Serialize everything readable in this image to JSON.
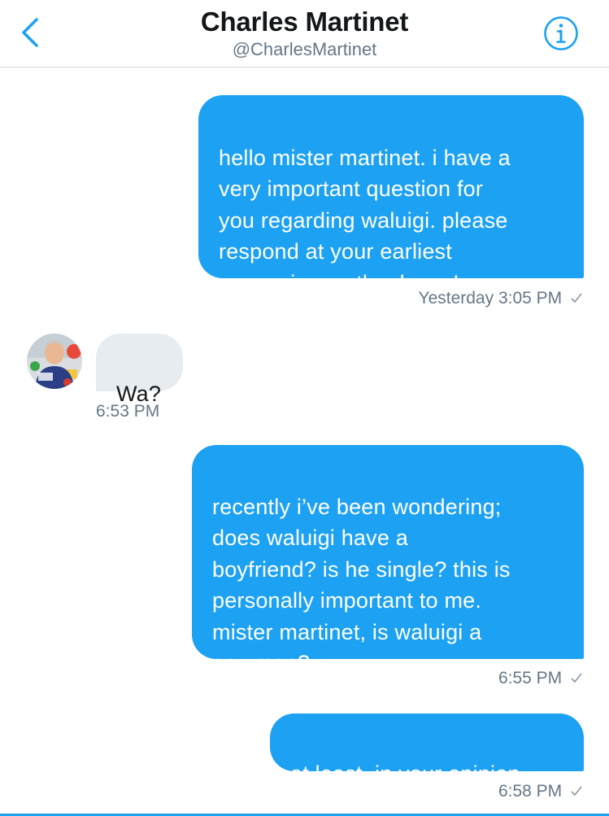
{
  "header": {
    "name": "Charles Martinet",
    "handle": "@CharlesMartinet",
    "back_icon": "chevron-left-icon",
    "info_icon": "info-circle-icon",
    "accent_color": "#1da1f2"
  },
  "messages": [
    {
      "direction": "outgoing",
      "text": "hello mister martinet. i have a\nvery important question for\nyou regarding waluigi. please\nrespond at your earliest\nconvenience. thank you!",
      "timestamp": "Yesterday 3:05 PM"
    },
    {
      "direction": "incoming",
      "text": "Wa?",
      "timestamp": "6:53 PM"
    },
    {
      "direction": "outgoing",
      "text": "recently i’ve been wondering;\ndoes waluigi have a\nboyfriend? is he single? this is\npersonally important to me.\nmister martinet, is waluigi a\ngay man?",
      "timestamp": "6:55 PM"
    },
    {
      "direction": "outgoing",
      "text": "at least, in your opinion.",
      "timestamp": "6:58 PM"
    }
  ],
  "colors": {
    "outgoing_bubble": "#1da1f2",
    "incoming_bubble": "#e6ecf0",
    "timestamp_text": "#657786"
  }
}
